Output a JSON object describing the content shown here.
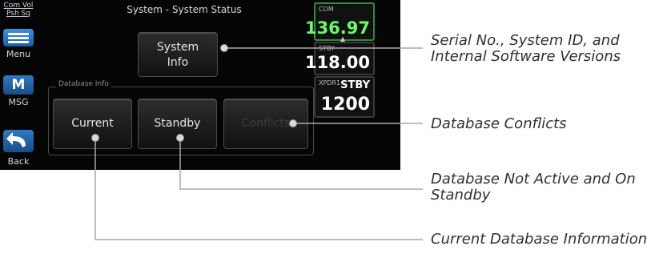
{
  "screen": {
    "top_left": {
      "line1": "Com Vol",
      "line2": "Psh Sq"
    },
    "title": "System - System Status",
    "left_tabs": {
      "menu": "Menu",
      "msg_glyph": "M",
      "msg": "MSG",
      "back": "Back"
    },
    "system_info_button": {
      "line1": "System",
      "line2": "Info"
    },
    "database_group_label": "Database Info",
    "buttons": {
      "current": "Current",
      "standby": "Standby",
      "conflicts": "Conflicts"
    },
    "com": {
      "label": "COM",
      "active": "136.97"
    },
    "stby": {
      "label": "STBY",
      "value": "118.00"
    },
    "xpdr": {
      "label": "XPDR1",
      "mode": "STBY",
      "code": "1200"
    },
    "colors": {
      "com_active": "#66ff66",
      "accent_blue": "#2f79c4"
    }
  },
  "callouts": {
    "system_info": {
      "line1": "Serial No., System ID, and",
      "line2": "Internal Software Versions"
    },
    "conflicts": "Database Conflicts",
    "standby": {
      "line1": "Database Not Active and On",
      "line2": "Standby"
    },
    "current": "Current Database Information"
  }
}
